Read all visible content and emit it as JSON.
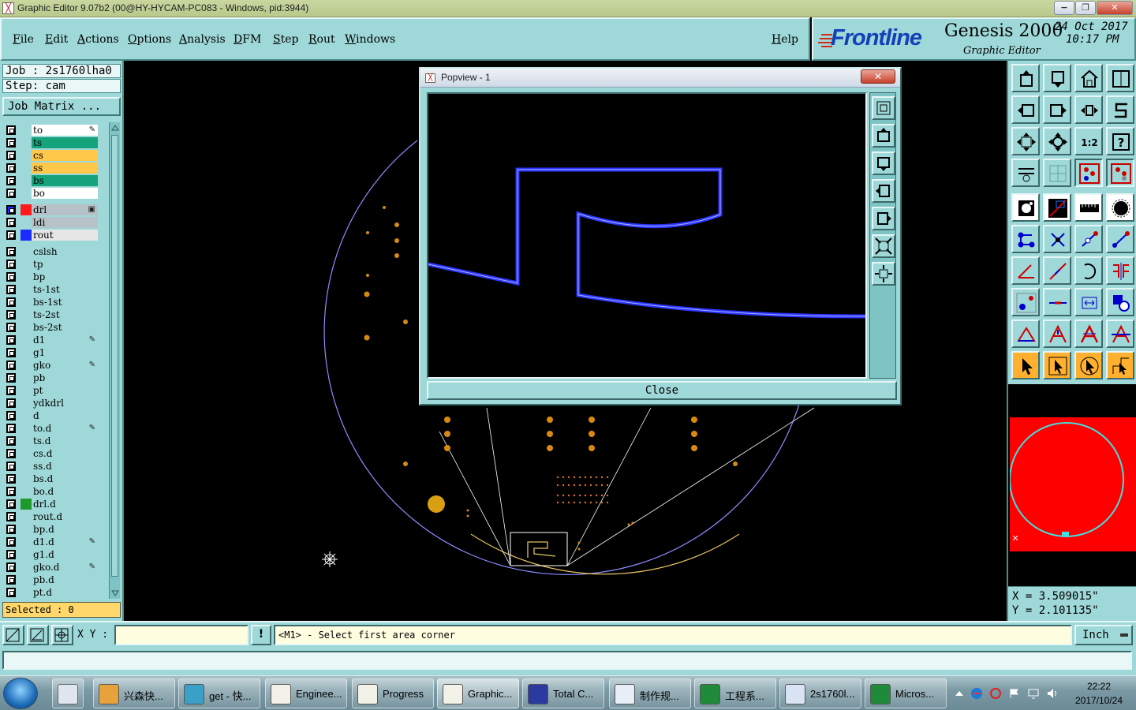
{
  "window": {
    "title": "Graphic Editor 9.07b2 (00@HY-HYCAM-PC083 - Windows, pid:3944)",
    "minimize": "−",
    "restore": "❐",
    "close": "✕"
  },
  "menu": {
    "items": [
      "File",
      "Edit",
      "Actions",
      "Options",
      "Analysis",
      "DFM",
      "Step",
      "Rout",
      "Windows"
    ],
    "help": "Help"
  },
  "brand": {
    "logo": "Frontline",
    "product": "Genesis 2000",
    "subtitle": "Graphic Editor",
    "date": "24 Oct 2017",
    "time": "10:17 PM"
  },
  "left": {
    "job": "Job : 2s1760lha0",
    "step": "Step: cam",
    "job_matrix": "Job Matrix ...",
    "selected": "Selected : 0",
    "layers": [
      {
        "name": "to",
        "color": "#ffffff",
        "mark": "✎"
      },
      {
        "name": "ts",
        "color": "#14a37a"
      },
      {
        "name": "cs",
        "color": "#ffc84a"
      },
      {
        "name": "ss",
        "color": "#ffc84a"
      },
      {
        "name": "bs",
        "color": "#14a37a"
      },
      {
        "name": "bo",
        "color": "#ffffff"
      },
      {
        "name": "drl",
        "color": "#b7c2c8",
        "affect": "#ff1a1a",
        "mark": "▣",
        "active": true
      },
      {
        "name": "ldi",
        "color": "#b7c2c8"
      },
      {
        "name": "rout",
        "color": "#e6e6e6",
        "affect": "#1a2cff"
      },
      {
        "name": "cslsh",
        "color": "#9fd8d8"
      },
      {
        "name": "tp",
        "color": "#9fd8d8"
      },
      {
        "name": "bp",
        "color": "#9fd8d8"
      },
      {
        "name": "ts-1st",
        "color": "#9fd8d8"
      },
      {
        "name": "bs-1st",
        "color": "#9fd8d8"
      },
      {
        "name": "ts-2st",
        "color": "#9fd8d8"
      },
      {
        "name": "bs-2st",
        "color": "#9fd8d8"
      },
      {
        "name": "d1",
        "color": "#9fd8d8",
        "mark": "✎"
      },
      {
        "name": "g1",
        "color": "#9fd8d8"
      },
      {
        "name": "gko",
        "color": "#9fd8d8",
        "mark": "✎"
      },
      {
        "name": "pb",
        "color": "#9fd8d8"
      },
      {
        "name": "pt",
        "color": "#9fd8d8"
      },
      {
        "name": "ydkdrl",
        "color": "#9fd8d8"
      },
      {
        "name": "d",
        "color": "#9fd8d8"
      },
      {
        "name": "to.d",
        "color": "#9fd8d8",
        "mark": "✎"
      },
      {
        "name": "ts.d",
        "color": "#9fd8d8"
      },
      {
        "name": "cs.d",
        "color": "#9fd8d8"
      },
      {
        "name": "ss.d",
        "color": "#9fd8d8"
      },
      {
        "name": "bs.d",
        "color": "#9fd8d8"
      },
      {
        "name": "bo.d",
        "color": "#9fd8d8"
      },
      {
        "name": "drl.d",
        "color": "#9fd8d8",
        "affect": "#1f9a2a"
      },
      {
        "name": "rout.d",
        "color": "#9fd8d8"
      },
      {
        "name": "bp.d",
        "color": "#9fd8d8"
      },
      {
        "name": "d1.d",
        "color": "#9fd8d8",
        "mark": "✎"
      },
      {
        "name": "g1.d",
        "color": "#9fd8d8"
      },
      {
        "name": "gko.d",
        "color": "#9fd8d8",
        "mark": "✎"
      },
      {
        "name": "pb.d",
        "color": "#9fd8d8"
      },
      {
        "name": "pt.d",
        "color": "#9fd8d8"
      }
    ]
  },
  "popview": {
    "title": "Popview - 1",
    "close_x": "✕",
    "close_button": "Close"
  },
  "coords": {
    "x": "X = 3.509015\"",
    "y": "Y = 2.101135\""
  },
  "command": {
    "xy_label": "X Y :",
    "xy_value": "",
    "excl": "!",
    "prompt": "<M1> - Select first area corner",
    "units": "Inch"
  },
  "taskbar": {
    "items": [
      {
        "label": "兴森快...",
        "color": "#e8a23c"
      },
      {
        "label": "get - 快...",
        "color": "#3aa0c8"
      },
      {
        "label": "Enginee...",
        "color": "#f2f2e8"
      },
      {
        "label": "Progress",
        "color": "#f2f2e8"
      },
      {
        "label": "Graphic...",
        "color": "#f2f2e8"
      },
      {
        "label": "Total C...",
        "color": "#2a3aa0"
      },
      {
        "label": "制作规...",
        "color": "#e8eef8"
      },
      {
        "label": "工程系...",
        "color": "#1f8a3a"
      },
      {
        "label": "2s1760l...",
        "color": "#d8e4f4"
      },
      {
        "label": "Micros...",
        "color": "#1f8a3a"
      }
    ],
    "time": "22:22",
    "date": "2017/10/24"
  }
}
